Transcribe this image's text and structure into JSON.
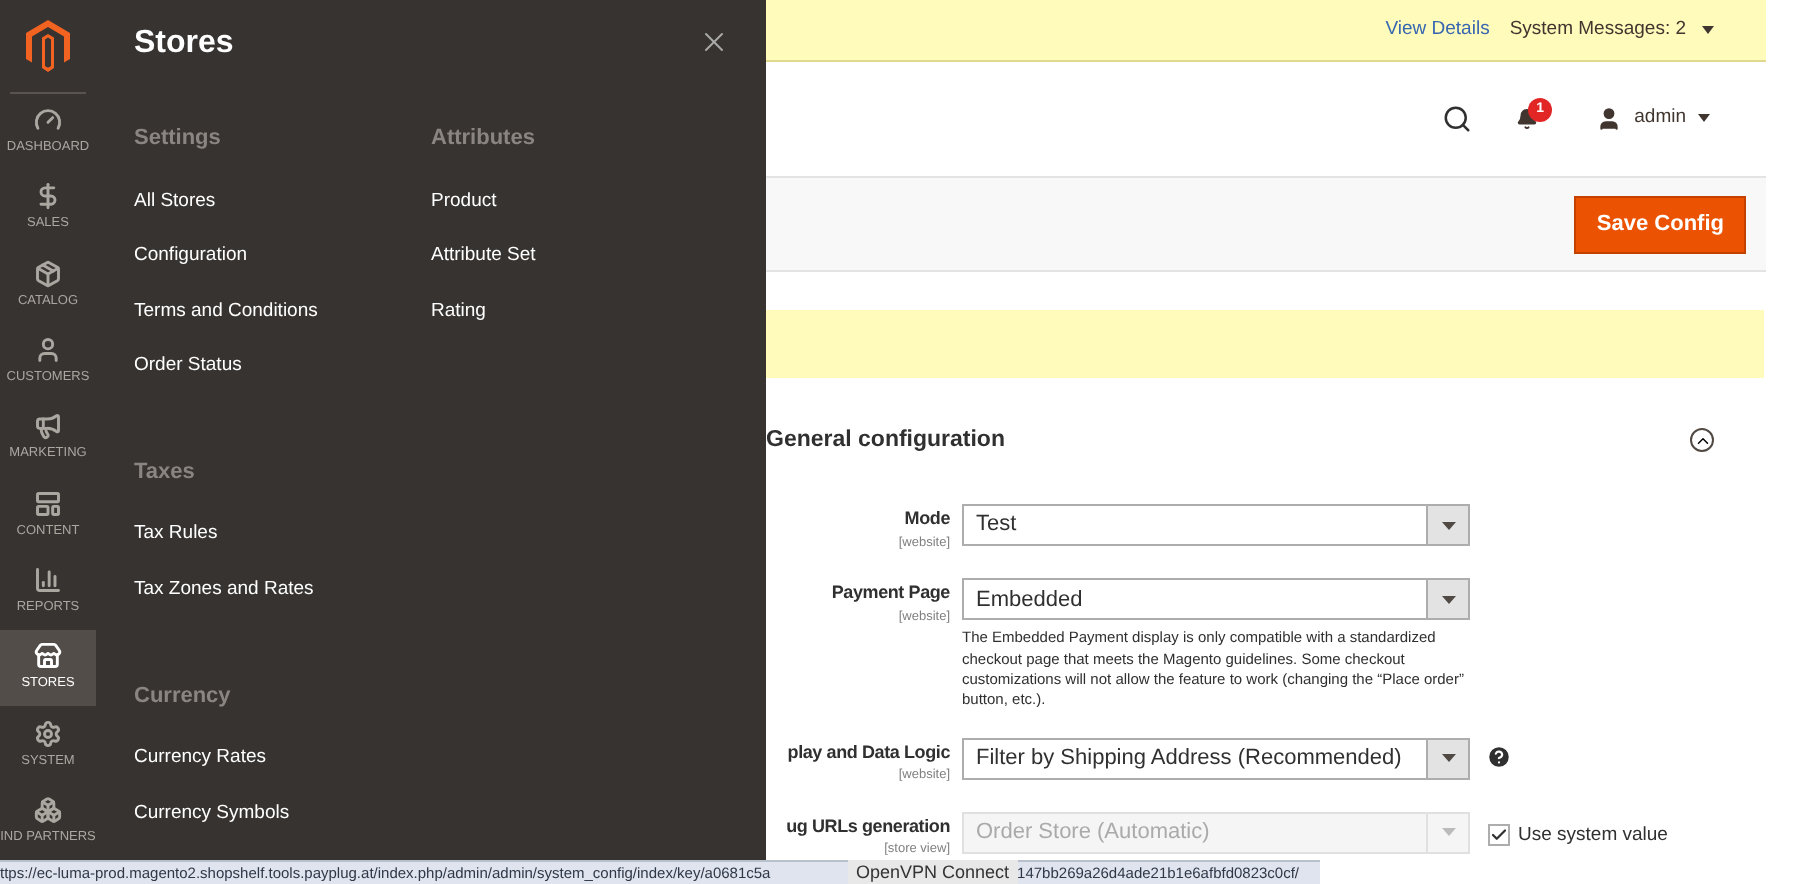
{
  "sidebar": {
    "items": [
      {
        "label": "DASHBOARD",
        "selected": false
      },
      {
        "label": "SALES",
        "selected": false
      },
      {
        "label": "CATALOG",
        "selected": false
      },
      {
        "label": "CUSTOMERS",
        "selected": false
      },
      {
        "label": "MARKETING",
        "selected": false
      },
      {
        "label": "CONTENT",
        "selected": false
      },
      {
        "label": "REPORTS",
        "selected": false
      },
      {
        "label": "STORES",
        "selected": true
      },
      {
        "label": "SYSTEM",
        "selected": false
      },
      {
        "label": "IND PARTNERS",
        "selected": false
      }
    ]
  },
  "flyout": {
    "title": "Stores",
    "columns": [
      {
        "groups": [
          {
            "heading": "Settings",
            "links": [
              "All Stores",
              "Configuration",
              "Terms and Conditions",
              "Order Status"
            ]
          },
          {
            "heading": "Taxes",
            "links": [
              "Tax Rules",
              "Tax Zones and Rates"
            ]
          },
          {
            "heading": "Currency",
            "links": [
              "Currency Rates",
              "Currency Symbols"
            ]
          }
        ]
      },
      {
        "groups": [
          {
            "heading": "Attributes",
            "links": [
              "Product",
              "Attribute Set",
              "Rating"
            ]
          }
        ]
      }
    ]
  },
  "notice_bar": {
    "link": "View Details",
    "messages": "System Messages: 2"
  },
  "header": {
    "notification_count": "1",
    "user": "admin"
  },
  "actions": {
    "save": "Save Config"
  },
  "section": {
    "title": "General configuration",
    "expanded": true
  },
  "fields": [
    {
      "label": "Mode",
      "scope": "[website]",
      "value": "Test",
      "disabled": false
    },
    {
      "label": "Payment Page",
      "scope": "[website]",
      "value": "Embedded",
      "disabled": false,
      "note": "The Embedded Payment display is only compatible with a standardized checkout page that meets the Magento guidelines. Some checkout customizations will not allow the feature to work (changing the “Place order” button, etc.)."
    },
    {
      "label": "play and Data Logic",
      "scope": "[website]",
      "value": "Filter by Shipping Address (Recommended)",
      "disabled": false,
      "help": true
    },
    {
      "label": "ug URLs generation",
      "scope": "[store view]",
      "value": "Order Store (Automatic)",
      "disabled": true,
      "use_system": {
        "label": "Use system value",
        "checked": true
      }
    }
  ],
  "status_bar": {
    "url_start": "ttps://ec-luma-prod.magento2.shopshelf.tools.payplug.at/index.php/admin/admin/system_config/index/key/a0681c5a",
    "tooltip": "OpenVPN Connect",
    "url_end": "147bb269a26d4ade21b1e6afbfd0823c0cf/"
  }
}
